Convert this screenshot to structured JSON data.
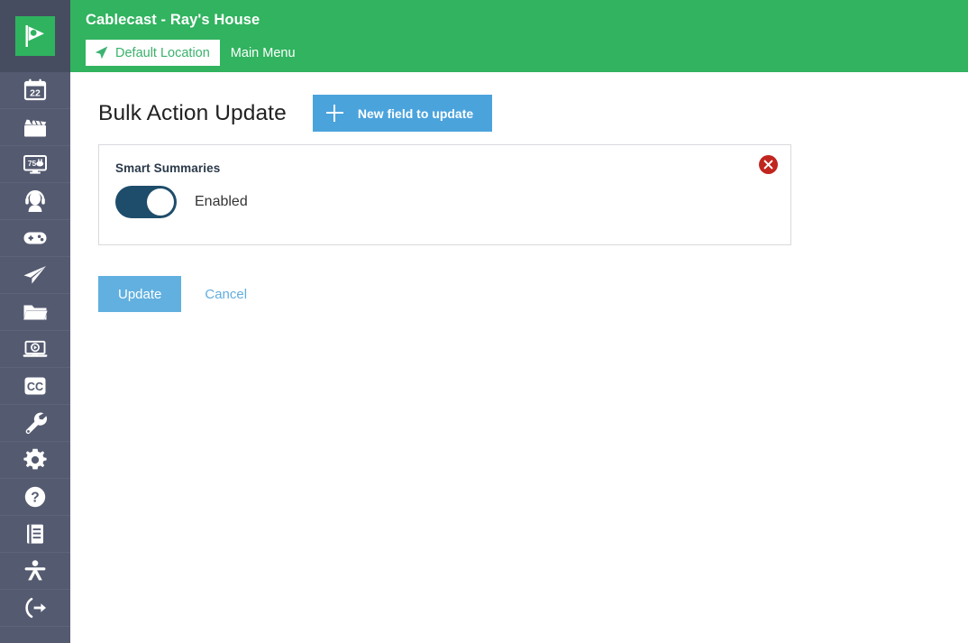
{
  "brand": {
    "logo_icon": "cablecast-flag-play-logo",
    "logo_bg": "#2fb35f"
  },
  "header": {
    "title": "Cablecast - Ray's House",
    "background": "#31b35f",
    "location_tab": {
      "icon": "location-arrow-icon",
      "label": "Default Location"
    },
    "main_menu": {
      "label": "Main Menu"
    }
  },
  "sidebar": {
    "background": "#545a70",
    "items": [
      {
        "name": "schedule",
        "icon": "calendar-22-icon"
      },
      {
        "name": "shows",
        "icon": "clapperboard-icon"
      },
      {
        "name": "channels",
        "icon": "tv-75-icon"
      },
      {
        "name": "live-production",
        "icon": "headset-person-icon"
      },
      {
        "name": "automation",
        "icon": "gamepad-icon"
      },
      {
        "name": "publishing",
        "icon": "paper-plane-icon"
      },
      {
        "name": "media",
        "icon": "folder-icon"
      },
      {
        "name": "digital-files",
        "icon": "laptop-play-icon"
      },
      {
        "name": "captioning",
        "icon": "cc-icon"
      },
      {
        "name": "tools",
        "icon": "wrench-icon"
      },
      {
        "name": "settings",
        "icon": "gear-icon"
      },
      {
        "name": "help",
        "icon": "question-circle-icon"
      },
      {
        "name": "reports",
        "icon": "book-icon"
      },
      {
        "name": "accessibility",
        "icon": "person-figure-icon"
      },
      {
        "name": "logout",
        "icon": "logout-arrow-icon"
      }
    ]
  },
  "main": {
    "page_title": "Bulk Action Update",
    "new_field_button": {
      "label": "New field to update",
      "icon": "plus-icon",
      "color": "#4ba3dc"
    },
    "field_card": {
      "label": "Smart Summaries",
      "toggle": {
        "state": "on",
        "state_label": "Enabled",
        "on_color": "#1e4d6b"
      },
      "remove_button": {
        "icon": "close-x-icon",
        "color": "#c1251f"
      }
    },
    "actions": {
      "update_label": "Update",
      "update_color": "#61b0e0",
      "cancel_label": "Cancel",
      "cancel_color": "#62aede"
    }
  }
}
